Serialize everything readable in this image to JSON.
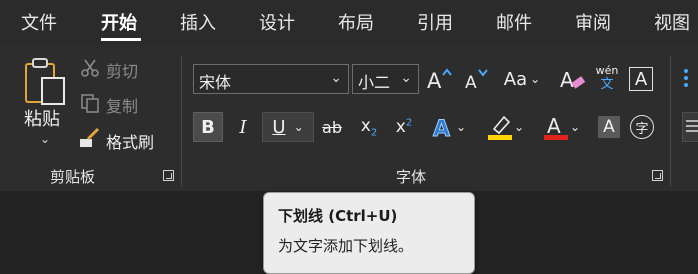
{
  "tabs": [
    {
      "label": "文件"
    },
    {
      "label": "开始",
      "active": true
    },
    {
      "label": "插入"
    },
    {
      "label": "设计"
    },
    {
      "label": "布局"
    },
    {
      "label": "引用"
    },
    {
      "label": "邮件"
    },
    {
      "label": "审阅"
    },
    {
      "label": "视图"
    }
  ],
  "clipboard": {
    "paste_label": "粘贴",
    "cut_label": "剪切",
    "copy_label": "复制",
    "format_painter_label": "格式刷",
    "group_label": "剪贴板"
  },
  "font": {
    "font_name": "宋体",
    "font_size": "小二",
    "group_label": "字体",
    "pinyin_top": "wén",
    "pinyin_bottom": "文",
    "enclose_char": "字",
    "highlight_color": "#ffd400",
    "font_color": "#e2231a"
  },
  "tooltip": {
    "title": "下划线 (Ctrl+U)",
    "description": "为文字添加下划线。"
  }
}
